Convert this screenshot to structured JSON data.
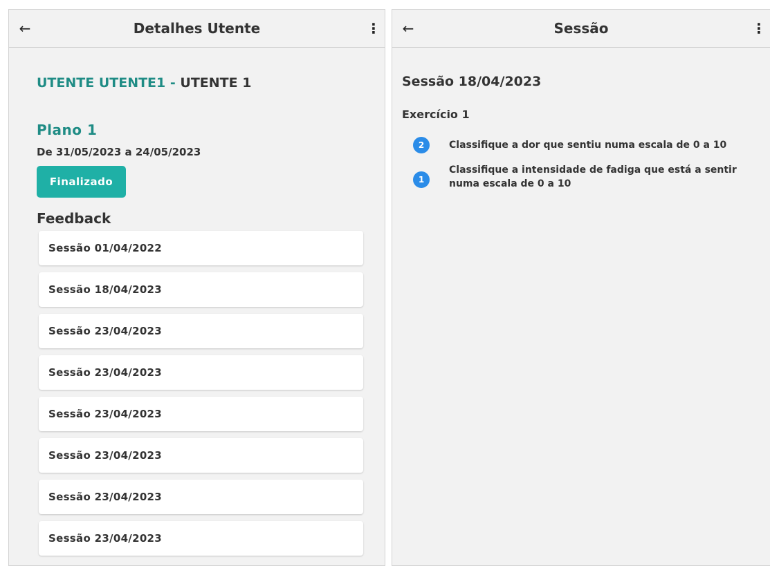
{
  "left": {
    "appbar": {
      "back_icon": "arrow-left-icon",
      "title": "Detalhes Utente",
      "menu_icon": "more-vertical-icon"
    },
    "patient": {
      "name_primary": "UTENTE UTENTE1",
      "separator": "-",
      "name_secondary": "UTENTE 1"
    },
    "plan": {
      "title": "Plano 1",
      "dates": "De 31/05/2023 a 24/05/2023",
      "status_label": "Finalizado"
    },
    "feedback": {
      "title": "Feedback",
      "sessions": [
        "Sessão 01/04/2022",
        "Sessão 18/04/2023",
        "Sessão 23/04/2023",
        "Sessão 23/04/2023",
        "Sessão 23/04/2023",
        "Sessão 23/04/2023",
        "Sessão 23/04/2023",
        "Sessão 23/04/2023"
      ]
    }
  },
  "right": {
    "appbar": {
      "back_icon": "arrow-left-icon",
      "title": "Sessão",
      "menu_icon": "more-vertical-icon"
    },
    "session_heading": "Sessão 18/04/2023",
    "exercise": {
      "title": "Exercício 1",
      "questions": [
        {
          "value": "2",
          "text": "Classifique a dor que sentiu numa escala de 0 a 10"
        },
        {
          "value": "1",
          "text": "Classifique a intensidade de fadiga que está a sentir numa escala de 0 a 10"
        }
      ]
    }
  },
  "colors": {
    "accent_teal": "#1f8c85",
    "button_teal": "#1fb0a6",
    "badge_blue": "#2b8ce8",
    "panel_bg": "#f2f2f2"
  }
}
